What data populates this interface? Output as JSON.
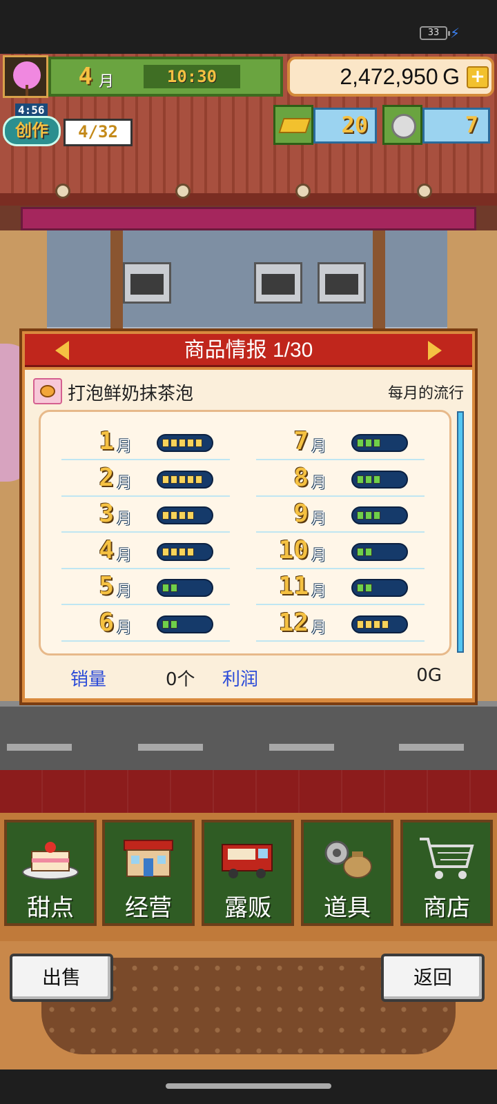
{
  "status_bar": {
    "battery": "33"
  },
  "hud": {
    "month_number": "4",
    "month_unit": "月",
    "time": "10:30",
    "money": "2,472,950 G",
    "create_timer": "4:56",
    "create_label": "创作",
    "create_count": "4/32",
    "gold_bars": "20",
    "tokens": "7"
  },
  "dialog": {
    "title": "商品情报 1/30",
    "item_name": "打泡鲜奶抹茶泡",
    "trend_label": "每月的流行",
    "months": [
      {
        "num": "1",
        "unit": "月",
        "level": 5,
        "color": "yellow"
      },
      {
        "num": "2",
        "unit": "月",
        "level": 5,
        "color": "yellow"
      },
      {
        "num": "3",
        "unit": "月",
        "level": 4,
        "color": "yellow"
      },
      {
        "num": "4",
        "unit": "月",
        "level": 4,
        "color": "yellow"
      },
      {
        "num": "5",
        "unit": "月",
        "level": 2,
        "color": "green"
      },
      {
        "num": "6",
        "unit": "月",
        "level": 2,
        "color": "green"
      },
      {
        "num": "7",
        "unit": "月",
        "level": 3,
        "color": "green"
      },
      {
        "num": "8",
        "unit": "月",
        "level": 3,
        "color": "green"
      },
      {
        "num": "9",
        "unit": "月",
        "level": 3,
        "color": "green"
      },
      {
        "num": "10",
        "unit": "月",
        "level": 2,
        "color": "green"
      },
      {
        "num": "11",
        "unit": "月",
        "level": 2,
        "color": "green"
      },
      {
        "num": "12",
        "unit": "月",
        "level": 4,
        "color": "yellow"
      }
    ],
    "sales_label": "销量",
    "sales_value": "0个",
    "profit_label": "利润",
    "profit_value": "0G"
  },
  "menu": {
    "items": [
      {
        "label": "甜点",
        "icon": "cake-icon"
      },
      {
        "label": "经营",
        "icon": "shop-icon"
      },
      {
        "label": "露贩",
        "icon": "food-truck-icon"
      },
      {
        "label": "道具",
        "icon": "items-icon"
      },
      {
        "label": "商店",
        "icon": "cart-icon"
      }
    ]
  },
  "bottom": {
    "sell_label": "出售",
    "back_label": "返回"
  }
}
